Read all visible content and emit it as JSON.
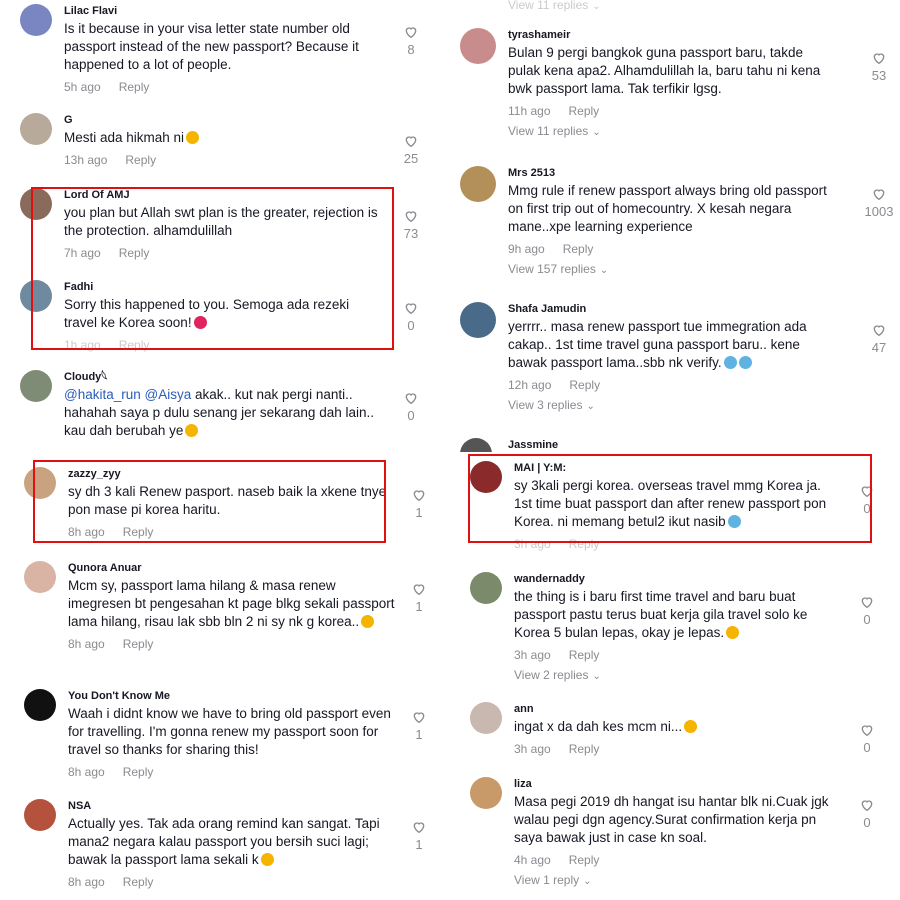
{
  "left": [
    {
      "user": "Lilac Flavi",
      "text": "Is it because in your visa letter state number old passport instead of the new passport? Because it happened to a lot of people.",
      "time": "5h ago",
      "reply": "Reply",
      "likes": "8",
      "avatar": "#7a86c2"
    },
    {
      "user": "G",
      "text": "Mesti ada hikmah ni",
      "emoji": "#f4b400",
      "time": "13h ago",
      "reply": "Reply",
      "likes": "25",
      "avatar": "#b8aa9a"
    },
    {
      "user": "Lord Of AMJ",
      "text": "you plan but Allah swt plan is the greater, rejection is the protection. alhamdulillah",
      "time": "7h ago",
      "reply": "Reply",
      "likes": "73",
      "avatar": "#8a6b5b"
    },
    {
      "user": "Fadhi",
      "text": "Sorry this happened to you. Semoga ada rezeki travel ke Korea soon!",
      "emoji": "#e0245e",
      "time": "1h ago",
      "reply": "Reply",
      "likes": "0",
      "avatar": "#6f8a9e"
    },
    {
      "user": "Cloudy𓆩",
      "mention1": "@hakita_run",
      "mention2": "@Aisya",
      "text": "akak.. kut nak pergi nanti.. hahahah saya p dulu senang jer sekarang dah lain.. kau dah berubah ye",
      "emoji": "#f4b400",
      "time": "",
      "reply": "",
      "likes": "0",
      "avatar": "#7f8c75"
    },
    {
      "user": "zazzy_zyy",
      "text": "sy dh 3 kali Renew pasport. naseb baik la xkene tnye pon mase pi korea haritu.",
      "time": "8h ago",
      "reply": "Reply",
      "likes": "1",
      "avatar": "#c9a27f"
    },
    {
      "user": "Qunora Anuar",
      "text": "Mcm sy, passport lama hilang & masa renew imegresen bt pengesahan kt page blkg sekali passport lama hilang, risau lak sbb bln 2 ni sy nk g korea..",
      "emoji": "#f4b400",
      "time": "8h ago",
      "reply": "Reply",
      "likes": "1",
      "avatar": "#d9b3a3"
    },
    {
      "user": "You Don't Know Me",
      "text": "Waah i didnt know we have to bring old passport even for travelling. I'm gonna renew my passport soon for travel so thanks for sharing this!",
      "time": "8h ago",
      "reply": "Reply",
      "likes": "1",
      "avatar": "#111111"
    },
    {
      "user": "NSA",
      "text": "Actually yes. Tak ada orang remind kan sangat. Tapi mana2 negara kalau passport you bersih suci lagi; bawak la passport lama sekali k",
      "emoji": "#f4b400",
      "time": "8h ago",
      "reply": "Reply",
      "likes": "1",
      "avatar": "#b5523d"
    }
  ],
  "right": [
    {
      "user": "",
      "text": "",
      "time": "",
      "reply": "",
      "replies": "View 11 replies",
      "likes": ""
    },
    {
      "user": "tyrashameir",
      "text": "Bulan 9 pergi bangkok guna passport baru, takde pulak kena apa2. Alhamdulillah la, baru tahu ni kena bwk passport lama. Tak terfikir lgsg.",
      "time": "11h ago",
      "reply": "Reply",
      "replies": "View 11 replies",
      "likes": "53",
      "avatar": "#c98c8c"
    },
    {
      "user": "Mrs 2513",
      "text": "Mmg rule if renew passport always bring old passport on first trip out of homecountry. X kesah negara mane..xpe learning experience",
      "time": "9h ago",
      "reply": "Reply",
      "replies": "View 157 replies",
      "likes": "1003",
      "avatar": "#b3905a"
    },
    {
      "user": "Shafa Jamudin",
      "text": "yerrrr.. masa renew passport tue immegration ada cakap.. 1st time travel guna passport baru.. kene bawak passport lama..sbb nk verify.",
      "emoji": "#5fb3e0",
      "time": "12h ago",
      "reply": "Reply",
      "replies": "View 3 replies",
      "likes": "47",
      "avatar": "#4a6a8a"
    },
    {
      "user": "Jassmine",
      "text": "",
      "time": "",
      "reply": "",
      "likes": "",
      "avatar": "#555"
    },
    {
      "user": "MAI | Y:M:",
      "text": "sy 3kali pergi korea. overseas travel mmg Korea ja. 1st time buat passport dan after renew passport pon Korea. ni memang betul2 ikut nasib",
      "emoji": "#5fb3e0",
      "time": "3h ago",
      "reply": "Reply",
      "likes": "0",
      "avatar": "#8a2a2a"
    },
    {
      "user": "wandernaddy",
      "text": "the thing is i baru first time travel and baru buat passport pastu terus buat kerja gila travel solo ke Korea 5 bulan lepas, okay je lepas.",
      "emoji": "#f4b400",
      "time": "3h ago",
      "reply": "Reply",
      "replies": "View 2 replies",
      "likes": "0",
      "avatar": "#7a8a6a"
    },
    {
      "user": "ann",
      "text": "ingat x da dah kes mcm ni...",
      "emoji": "#f4b400",
      "time": "3h ago",
      "reply": "Reply",
      "likes": "0",
      "avatar": "#c8b8b0"
    },
    {
      "user": "liza",
      "text": "Masa pegi 2019 dh hangat isu hantar blk ni.Cuak jgk walau pegi dgn agency.Surat confirmation kerja pn saya bawak just in case kn soal.",
      "time": "4h ago",
      "reply": "Reply",
      "replies": "View 1 reply",
      "likes": "0",
      "avatar": "#c89a6a"
    }
  ]
}
